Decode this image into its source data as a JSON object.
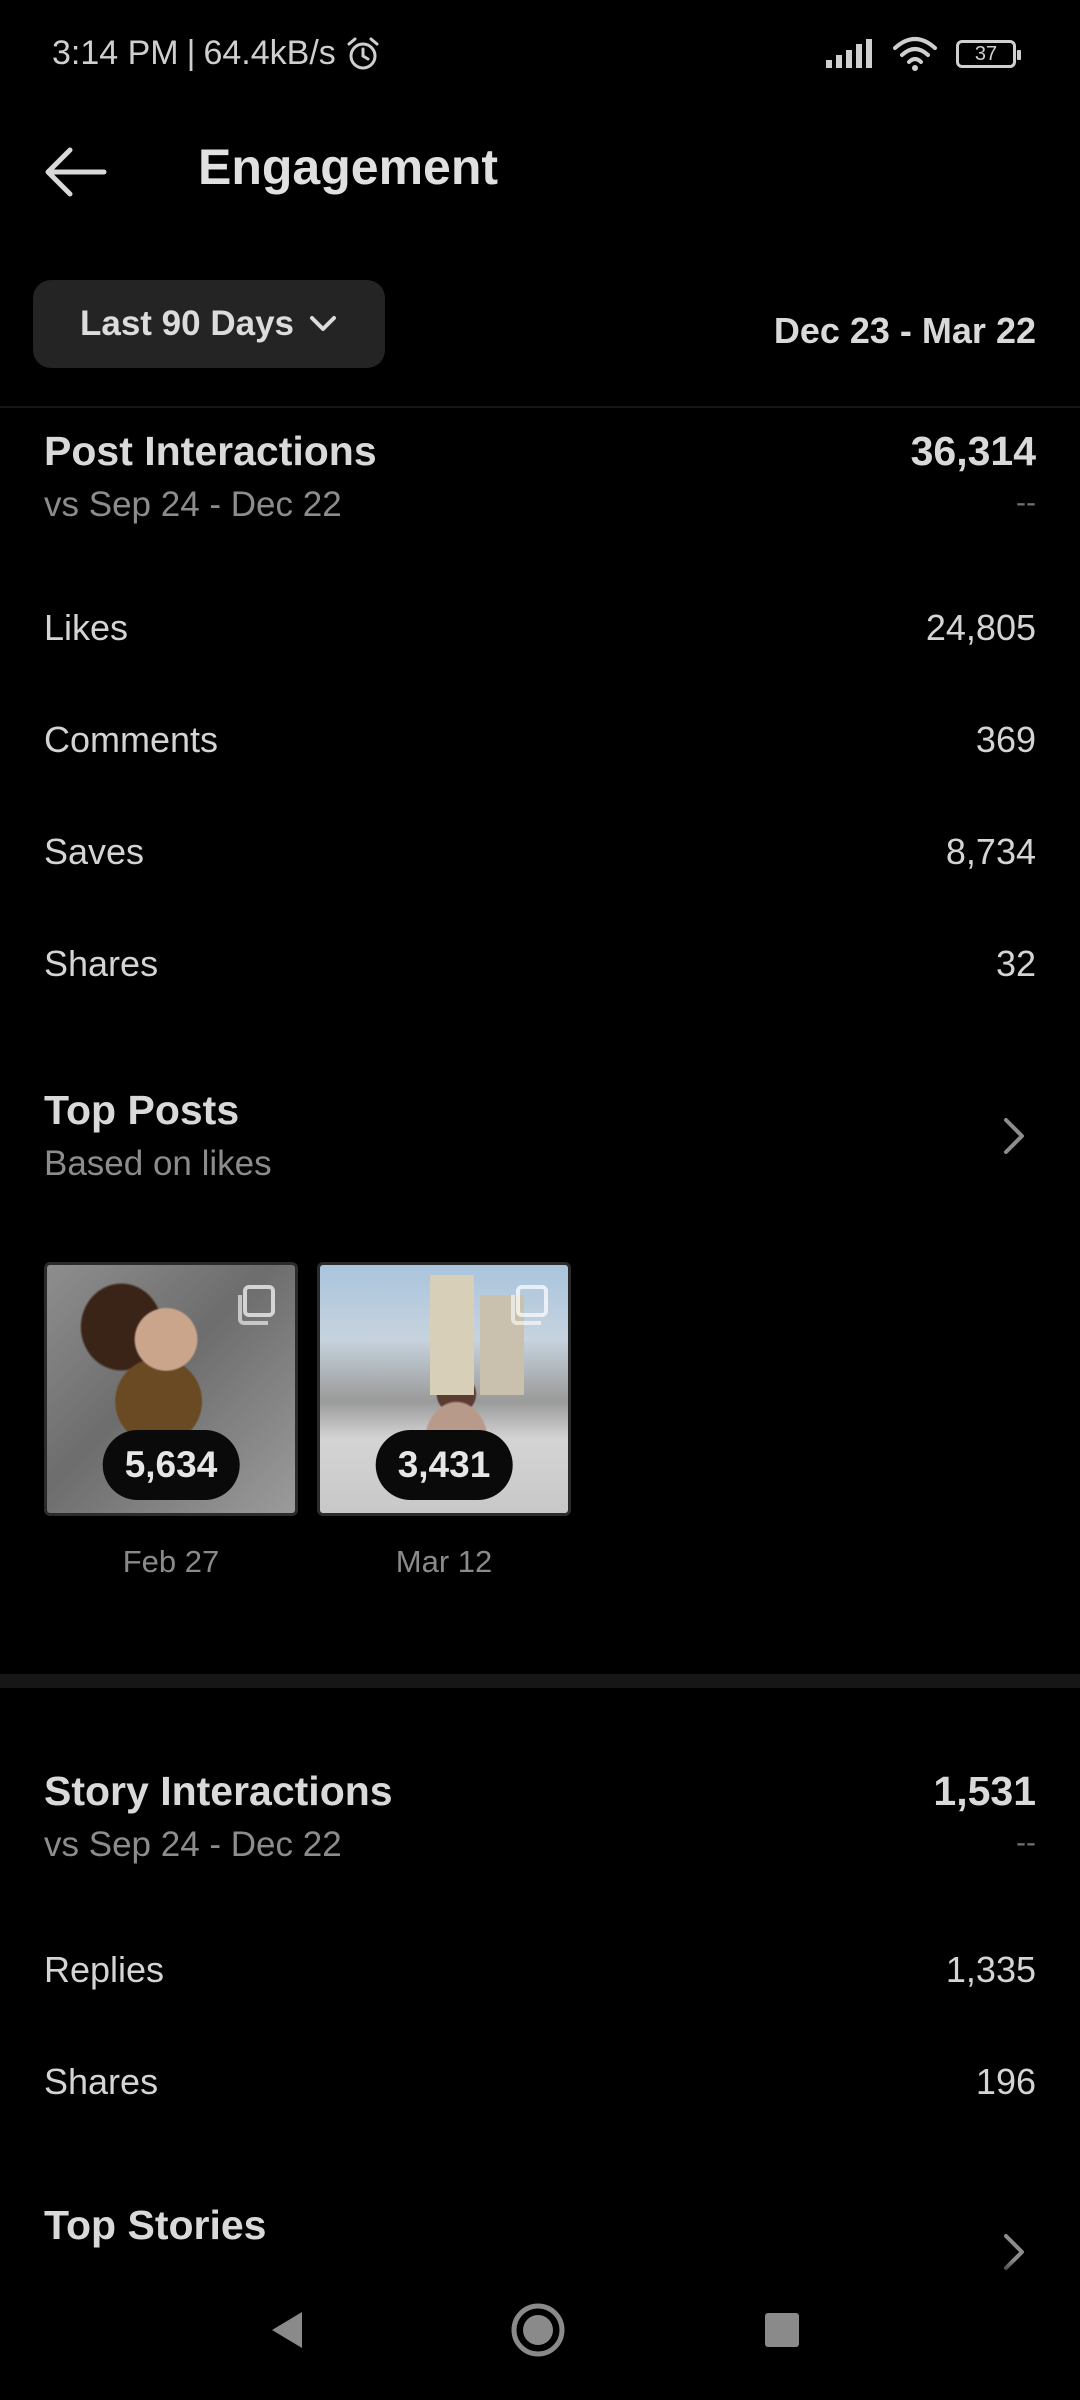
{
  "status_bar": {
    "time": "3:14 PM",
    "separator": "|",
    "network_speed": "64.4kB/s",
    "battery_level": "37"
  },
  "header": {
    "title": "Engagement"
  },
  "filter": {
    "range_label": "Last 90 Days",
    "date_range": "Dec 23 - Mar 22"
  },
  "post_interactions": {
    "title": "Post Interactions",
    "comparison": "vs Sep 24 - Dec 22",
    "total": "36,314",
    "change": "--",
    "rows": [
      {
        "label": "Likes",
        "value": "24,805"
      },
      {
        "label": "Comments",
        "value": "369"
      },
      {
        "label": "Saves",
        "value": "8,734"
      },
      {
        "label": "Shares",
        "value": "32"
      }
    ]
  },
  "top_posts": {
    "title": "Top Posts",
    "subtitle": "Based on likes",
    "posts": [
      {
        "count": "5,634",
        "date": "Feb 27"
      },
      {
        "count": "3,431",
        "date": "Mar 12"
      }
    ]
  },
  "story_interactions": {
    "title": "Story Interactions",
    "comparison": "vs Sep 24 - Dec 22",
    "total": "1,531",
    "change": "--",
    "rows": [
      {
        "label": "Replies",
        "value": "1,335"
      },
      {
        "label": "Shares",
        "value": "196"
      }
    ]
  },
  "top_stories": {
    "title": "Top Stories"
  },
  "colors": {
    "background": "#000000",
    "text_primary": "#d9d9d9",
    "text_secondary": "#8c8c8c",
    "button_bg": "#242424"
  },
  "icons": {
    "back": "arrow-left-icon",
    "alarm": "alarm-icon",
    "signal": "signal-icon",
    "wifi": "wifi-icon",
    "battery": "battery-icon",
    "dropdown": "chevron-down-icon",
    "open": "chevron-right-icon",
    "carousel": "carousel-icon",
    "nav_back": "nav-back-icon",
    "nav_home": "nav-home-icon",
    "nav_recents": "nav-recents-icon"
  }
}
